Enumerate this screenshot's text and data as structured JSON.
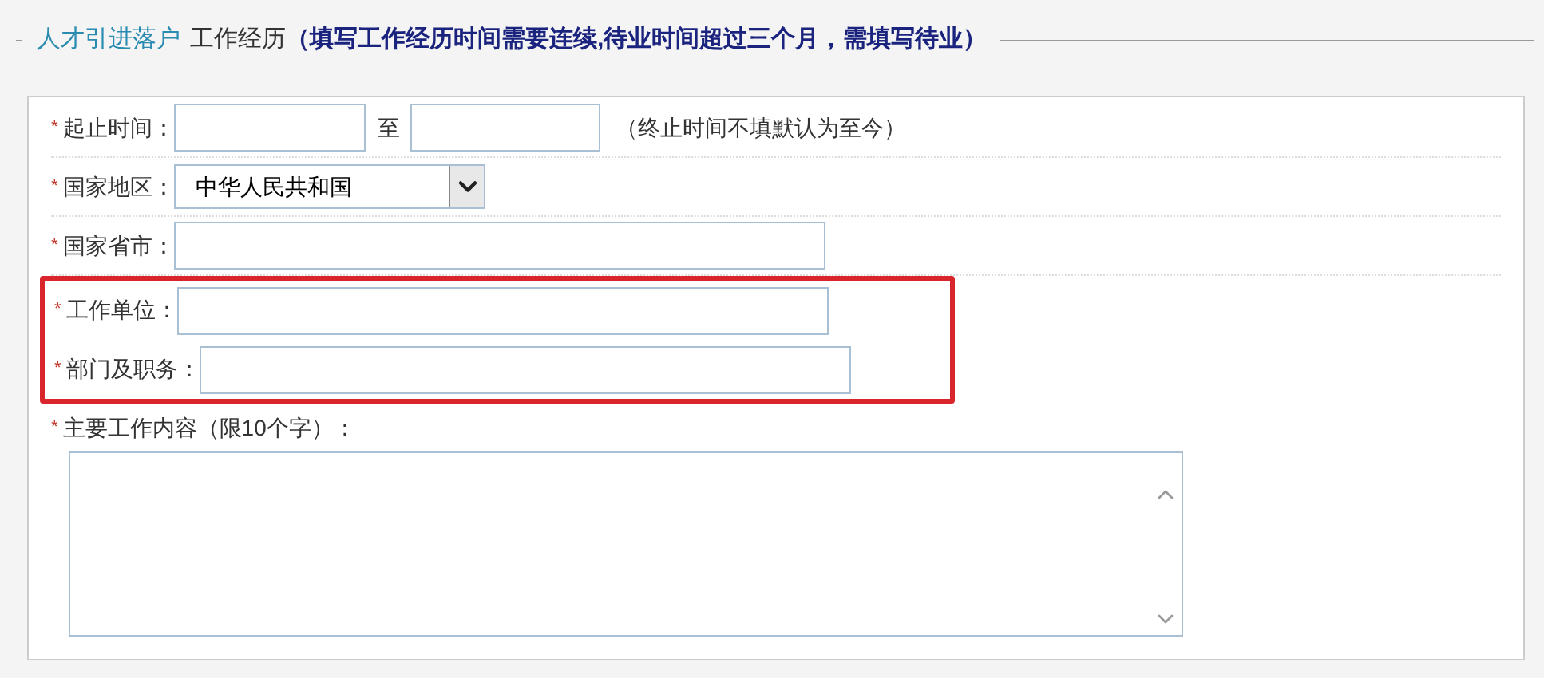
{
  "legend": {
    "prefix": "人才引进落户",
    "title": "工作经历",
    "note": "（填写工作经历时间需要连续,待业时间超过三个月，需填写待业）"
  },
  "rows": [
    {
      "kind": "date_range",
      "mark": "*",
      "label": "起止时间：",
      "separator": "至",
      "hint": "（终止时间不填默认为至今）"
    },
    {
      "kind": "select",
      "mark": "*",
      "label": "国家地区：",
      "value": "中华人民共和国"
    },
    {
      "kind": "text",
      "mark": "*",
      "label": "国家省市："
    },
    {
      "kind": "highlight",
      "children": [
        {
          "kind": "text",
          "mark": "*",
          "label": "工作单位："
        },
        {
          "kind": "text",
          "mark": "*",
          "label": "部门及职务："
        }
      ]
    },
    {
      "kind": "textarea",
      "mark": "*",
      "label": "主要工作内容（限10个字）："
    }
  ]
}
